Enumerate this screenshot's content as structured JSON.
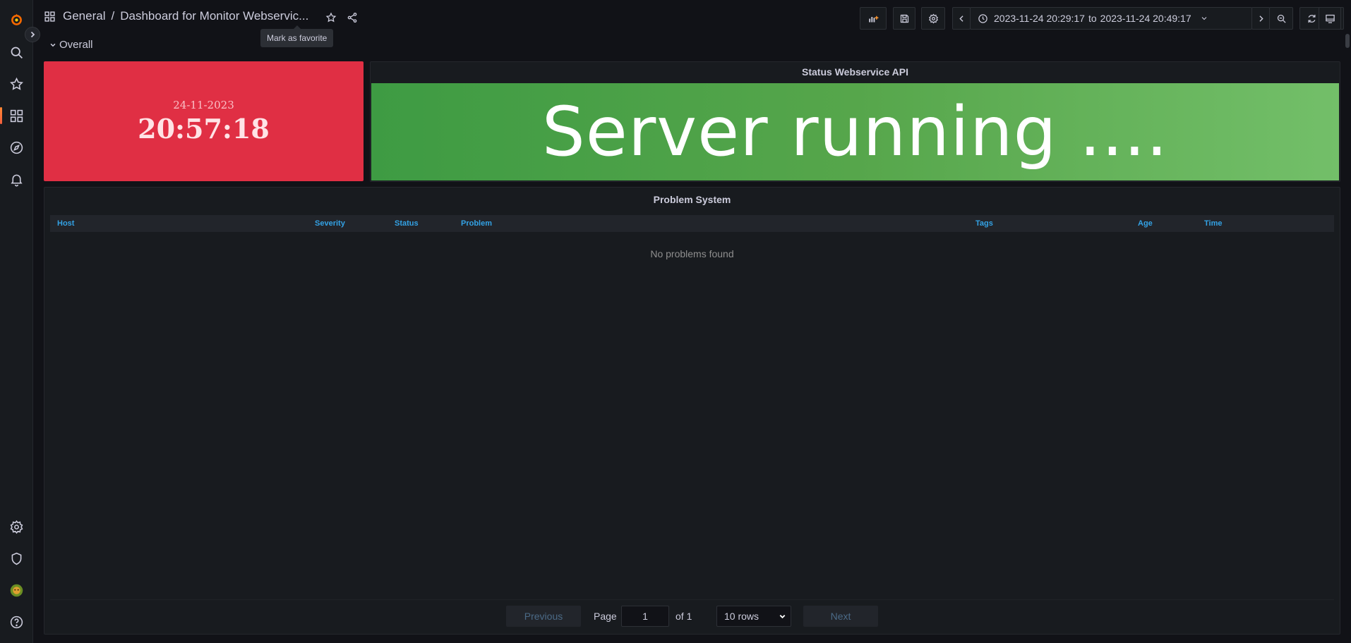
{
  "breadcrumb": {
    "folder": "General",
    "separator": "/",
    "dashboard": "Dashboard for Monitor Webservic..."
  },
  "tooltip": "Mark as favorite",
  "time_range": {
    "from": "2023-11-24 20:29:17",
    "to_word": "to",
    "to": "2023-11-24 20:49:17"
  },
  "row": {
    "title": "Overall"
  },
  "clock": {
    "date": "24-11-2023",
    "time": "20:57:18",
    "color": "#e02f44"
  },
  "status_panel": {
    "title": "Status Webservice API",
    "text": "Server running ....",
    "color": "#56a64b"
  },
  "problems": {
    "title": "Problem System",
    "columns": [
      "Host",
      "Severity",
      "Status",
      "Problem",
      "Tags",
      "Age",
      "Time"
    ],
    "empty_message": "No problems found",
    "pager": {
      "previous": "Previous",
      "page_label": "Page",
      "page": "1",
      "of_label": "of 1",
      "rows": "10 rows",
      "next": "Next"
    }
  },
  "icons": {
    "sidebar": [
      "grafana-logo-icon",
      "search-icon",
      "star-icon",
      "dashboards-icon",
      "explore-icon",
      "alerting-icon",
      "settings-icon",
      "shield-icon",
      "user-avatar-icon",
      "help-icon"
    ],
    "toolbar": [
      "add-panel-icon",
      "save-icon",
      "gear-icon",
      "chevron-left-icon",
      "clock-icon",
      "chevron-down-icon",
      "chevron-right-icon",
      "zoom-out-icon",
      "refresh-icon",
      "chevron-down-icon",
      "tv-mode-icon"
    ]
  }
}
